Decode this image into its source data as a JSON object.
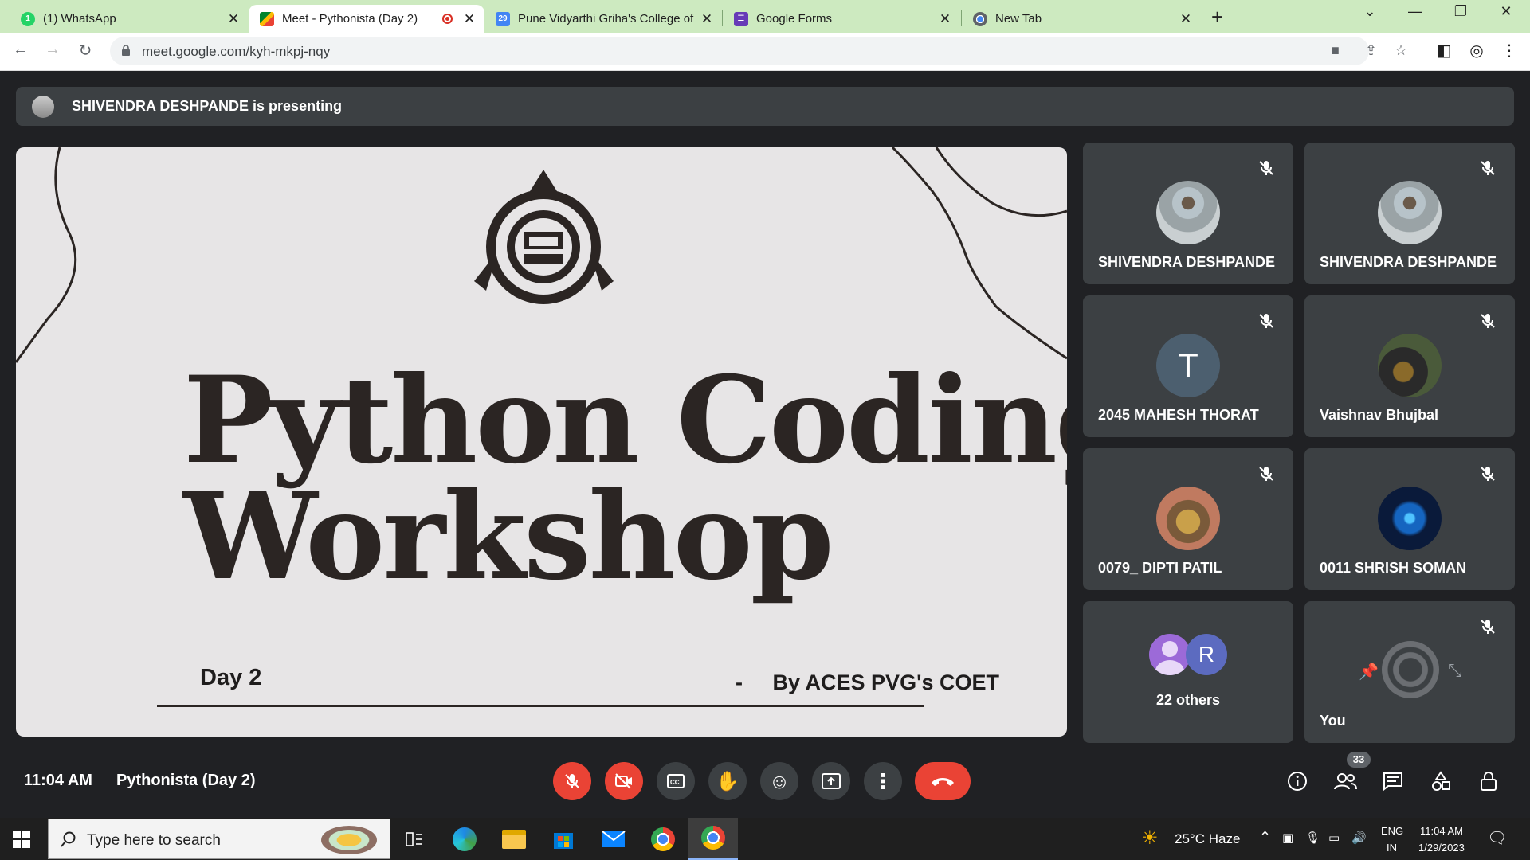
{
  "browser": {
    "tabs": [
      {
        "label": "(1) WhatsApp"
      },
      {
        "label": "Meet - Pythonista (Day 2)"
      },
      {
        "label": "Pune Vidyarthi Griha's College of"
      },
      {
        "label": "Google Forms"
      },
      {
        "label": "New Tab"
      }
    ],
    "url": "meet.google.com/kyh-mkpj-nqy"
  },
  "meet": {
    "presenting_text": "SHIVENDRA DESHPANDE is presenting",
    "slide": {
      "title_line1": "Python Coding",
      "title_line2": "Workshop",
      "day": "Day 2",
      "dash": "-",
      "byline": "By ACES PVG's COET"
    },
    "participants": [
      {
        "name": "SHIVENDRA DESHPANDE"
      },
      {
        "name": "SHIVENDRA DESHPANDE"
      },
      {
        "name": "2045 MAHESH THORAT",
        "initial": "T"
      },
      {
        "name": "Vaishnav Bhujbal"
      },
      {
        "name": "0079_ DIPTI PATIL"
      },
      {
        "name": "0011 SHRISH SOMAN"
      }
    ],
    "others": {
      "label": "22 others",
      "initial": "R"
    },
    "self": {
      "label": "You"
    },
    "clock": "11:04 AM",
    "meeting_title": "Pythonista (Day 2)",
    "people_count": "33"
  },
  "taskbar": {
    "search_placeholder": "Type here to search",
    "weather": "25°C  Haze",
    "lang1": "ENG",
    "lang2": "IN",
    "time": "11:04 AM",
    "date": "1/29/2023"
  },
  "colors": {
    "tabstrip": "#cdeac0",
    "meet_bg": "#202124",
    "tile_bg": "#3c4043",
    "danger": "#ea4335"
  }
}
